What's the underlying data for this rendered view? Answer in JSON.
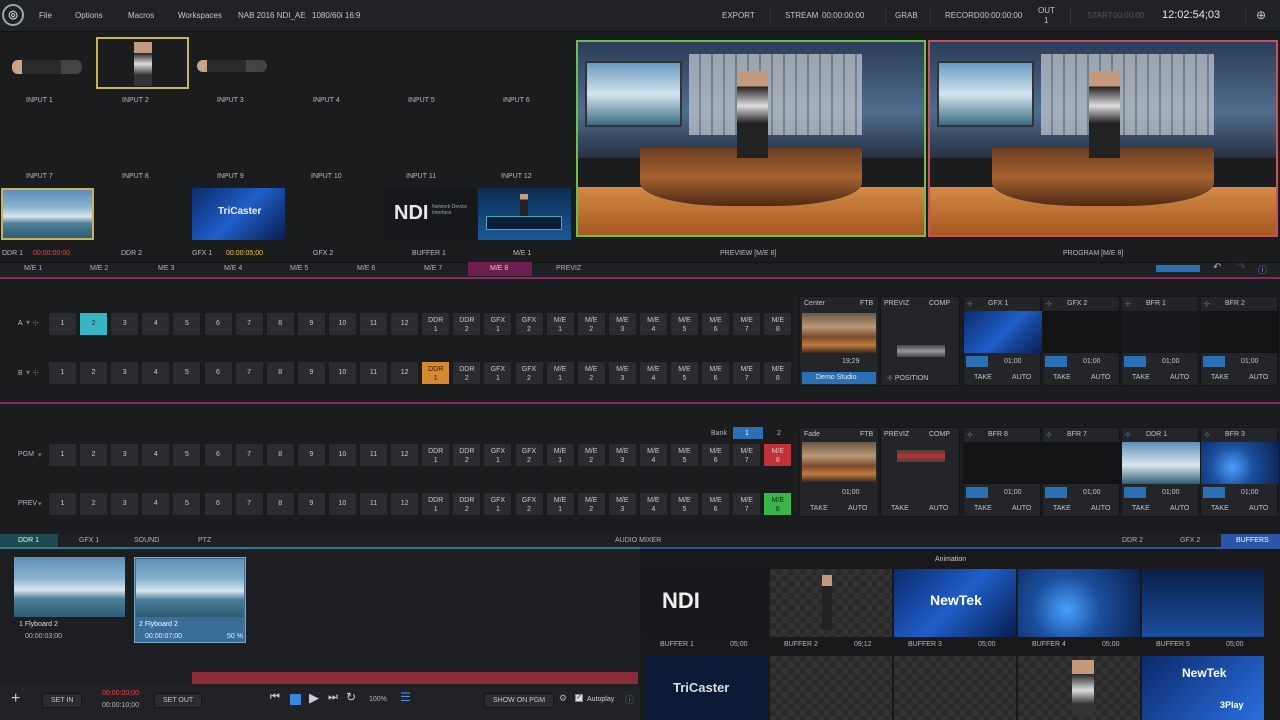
{
  "menu": {
    "file": "File",
    "options": "Options",
    "macros": "Macros",
    "workspaces": "Workspaces",
    "session": "NAB 2016 NDI_AE",
    "format": "1080/60i 16:9"
  },
  "status": {
    "export": "EXPORT",
    "stream": "STREAM",
    "stream_time": "00:00:00:00",
    "grab": "GRAB",
    "record": "RECORD",
    "record_time": "00:00:00:00",
    "out": "OUT",
    "out_num": "1",
    "start": "START",
    "start_time": "00:00:00",
    "clock": "12:02:54;03"
  },
  "inputs": [
    "INPUT 1",
    "INPUT 2",
    "INPUT 3",
    "INPUT 4",
    "INPUT 5",
    "INPUT 6",
    "INPUT 7",
    "INPUT 8",
    "INPUT 9",
    "INPUT 10",
    "INPUT 11",
    "INPUT 12"
  ],
  "sources": {
    "ddr1": "DDR 1",
    "ddr1_time": "00:00:00:00",
    "ddr2": "DDR 2",
    "gfx1": "GFX 1",
    "gfx1_time": "00:00:05;00",
    "gfx2": "GFX 2",
    "buffer1": "BUFFER 1",
    "me1": "M/E 1",
    "tricaster": "TriCaster",
    "ndi": "NDI",
    "ndi_sub": "Network Device Interface"
  },
  "monitors": {
    "preview": "PREVIEW [M/E 8]",
    "program": "PROGRAM [M/E 8]"
  },
  "me_tabs": [
    "M/E 1",
    "M/E 2",
    "ME 3",
    "M/E 4",
    "M/E 5",
    "M/E 6",
    "M/E 7",
    "M/E 8",
    "PREVIZ"
  ],
  "row_labels": {
    "a": "A",
    "b": "B",
    "pgm": "PGM",
    "prev": "PREV"
  },
  "nums": [
    "1",
    "2",
    "3",
    "4",
    "5",
    "6",
    "7",
    "8",
    "9",
    "10",
    "11",
    "12"
  ],
  "ext": [
    [
      "DDR",
      "1"
    ],
    [
      "DDR",
      "2"
    ],
    [
      "GFX",
      "1"
    ],
    [
      "GFX",
      "2"
    ],
    [
      "M/E",
      "1"
    ],
    [
      "M/E",
      "2"
    ],
    [
      "M/E",
      "3"
    ],
    [
      "M/E",
      "4"
    ],
    [
      "M/E",
      "5"
    ],
    [
      "M/E",
      "6"
    ],
    [
      "M/E",
      "7"
    ],
    [
      "M/E",
      "8"
    ]
  ],
  "me_panel": {
    "center": "Center",
    "ftb": "FTB",
    "time": "19;29",
    "demo": "Demo Studio",
    "previz": "PREVIZ",
    "comp": "COMP",
    "position": "POSITION",
    "keys_top": [
      "GFX 1",
      "GFX 2",
      "BFR 1",
      "BFR 2"
    ],
    "key_time": "01;00",
    "take": "TAKE",
    "auto": "AUTO"
  },
  "main_panel": {
    "bank": "Bank",
    "bank1": "1",
    "bank2": "2",
    "fade": "Fade",
    "ftb": "FTB",
    "time": "01;00",
    "previz": "PREVIZ",
    "comp": "COMP",
    "keys": [
      "BFR 8",
      "BFR 7",
      "DDR 1",
      "BFR 3"
    ],
    "key_time": "01;00",
    "take": "TAKE",
    "auto": "AUTO"
  },
  "bottom_tabs": {
    "ddr1": "DDR 1",
    "gfx1": "GFX 1",
    "sound": "SOUND",
    "ptz": "PTZ",
    "audio": "AUDIO MIXER",
    "ddr2": "DDR 2",
    "gfx2": "GFX 2",
    "buffers": "BUFFERS"
  },
  "clips": [
    {
      "name": "1 Flyboard 2",
      "time": "00:00:03;00"
    },
    {
      "name": "2 Flyboard 2",
      "time": "00:00:07;00",
      "pct": "50 %"
    }
  ],
  "transport": {
    "set_in": "SET IN",
    "in_time": "00:00:00;00",
    "out_time": "00:00:10;00",
    "set_out": "SET OUT",
    "speed": "100%",
    "show": "SHOW ON PGM",
    "autoplay": "Autoplay"
  },
  "animation": "Animation",
  "buffers": [
    {
      "name": "BUFFER 1",
      "time": "05;00"
    },
    {
      "name": "BUFFER 2",
      "time": "09;12"
    },
    {
      "name": "BUFFER 3",
      "time": "05;00"
    },
    {
      "name": "BUFFER 4",
      "time": "05;00"
    },
    {
      "name": "BUFFER 5",
      "time": "05;00"
    }
  ],
  "buffer_art": {
    "newtek": "NewTek",
    "tricaster": "TriCaster",
    "threeplay": "3Play"
  }
}
